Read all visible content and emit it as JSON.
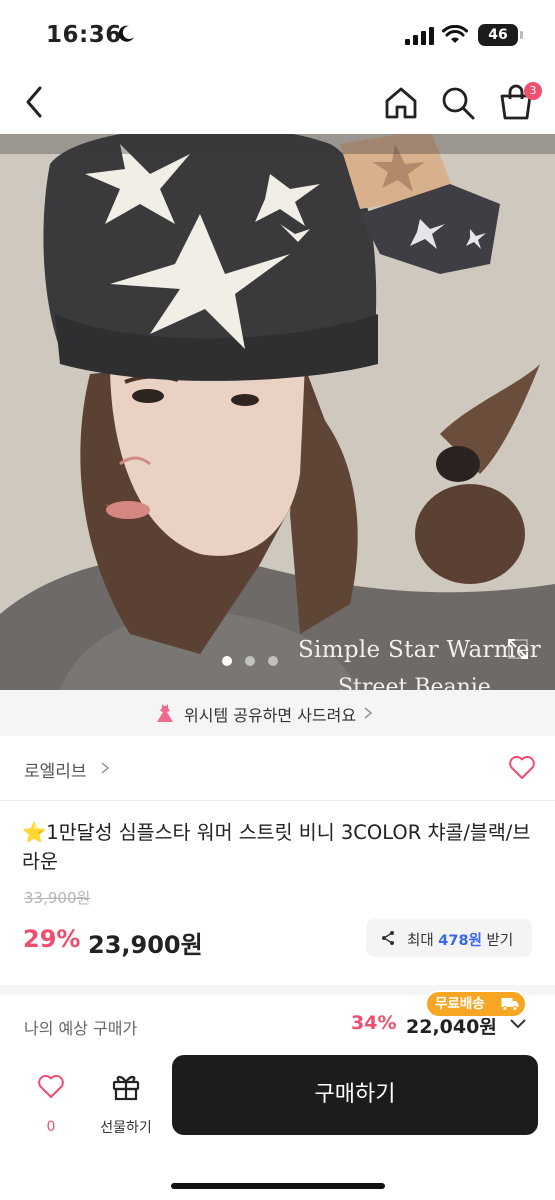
{
  "status_bar": {
    "time": "16:36",
    "battery": "46",
    "icons": [
      "moon-icon",
      "signal-icon",
      "wifi-icon",
      "battery-icon"
    ]
  },
  "header": {
    "icons": [
      "back-icon",
      "home-icon",
      "search-icon",
      "cart-icon"
    ],
    "cart_badge": "3"
  },
  "photo": {
    "caption_line1": "Simple Star Warmer",
    "caption_line2": "Street Beanie",
    "carousel_total": 3,
    "carousel_active": 1
  },
  "wish_banner": {
    "text": "위시템 공유하면 사드려요"
  },
  "brand": {
    "name": "로엘리브"
  },
  "product": {
    "star": "⭐",
    "title": "1만달성 심플스타 워머 스트릿 비니 3COLOR 챠콜/블랙/브라운",
    "original_price": "33,900원",
    "discount": "29%",
    "price": "23,900원",
    "reward_prefix": "최대",
    "reward_points": "478원",
    "reward_suffix": "받기"
  },
  "expected_price": {
    "label": "나의 예상 구매가",
    "discount": "34%",
    "price": "22,040원"
  },
  "bottom_bar": {
    "like_count": "0",
    "gift_label": "선물하기",
    "buy_label": "구매하기",
    "free_shipping": "무료배송"
  },
  "colors": {
    "accent_pink": "#f04e6f",
    "points_blue": "#3a66f2",
    "shipping_orange": "#f6a623",
    "buy_button": "#1c1c1e"
  }
}
